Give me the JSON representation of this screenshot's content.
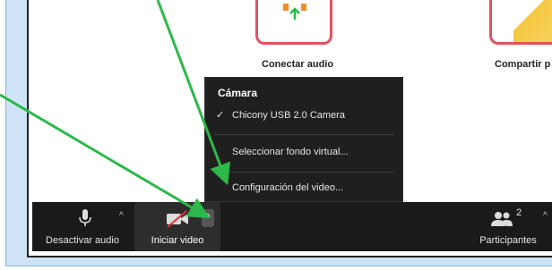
{
  "tiles": {
    "audio_label": "Conectar audio",
    "share_label": "Compartir p"
  },
  "camera_menu": {
    "title": "Cámara",
    "camera_device": "Chicony USB 2.0 Camera",
    "virtual_background": "Seleccionar fondo virtual...",
    "video_settings": "Configuración del video..."
  },
  "toolbar": {
    "audio_label": "Desactivar audio",
    "video_label": "Iniciar video",
    "participants_label": "Participantes",
    "participants_count": "2"
  },
  "icons": {
    "check": "✓",
    "caret_up": "^"
  },
  "colors": {
    "toolbar_bg": "#1a1a1a",
    "menu_bg": "#1f1f1f",
    "tile_border": "#e0525d",
    "annotation_arrow": "#2db84a",
    "video_off_slash": "#e0303a"
  }
}
